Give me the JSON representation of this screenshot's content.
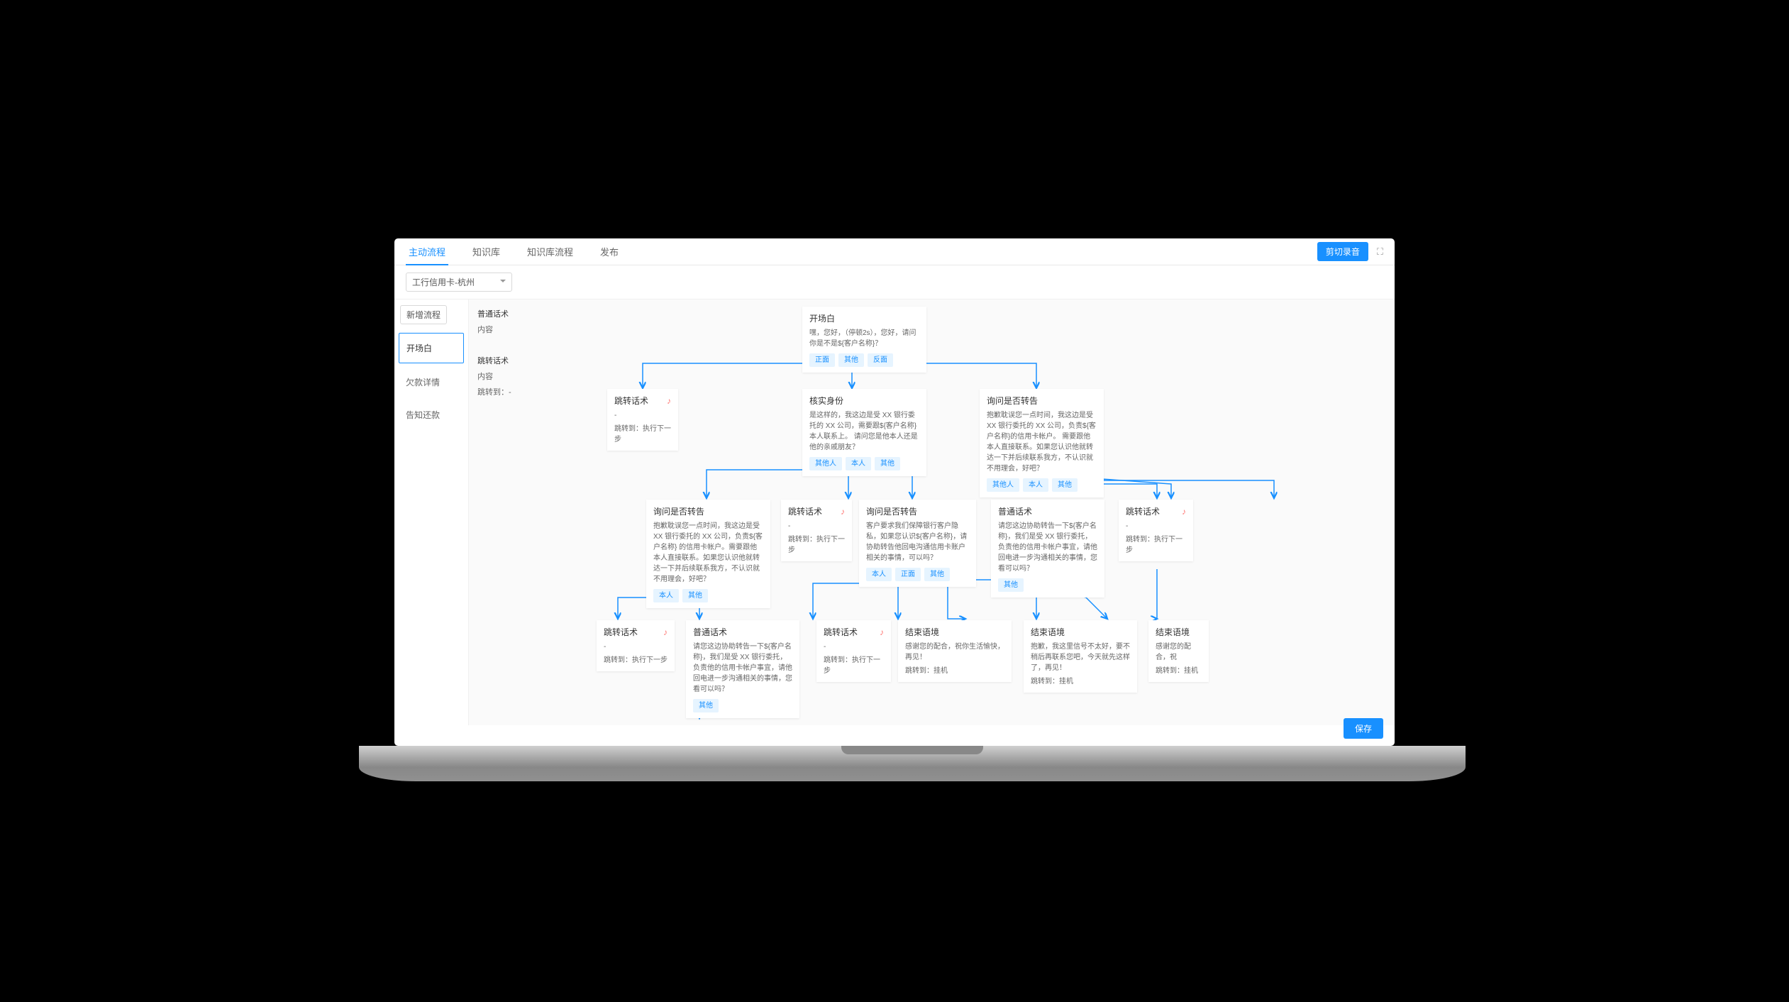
{
  "tabs": [
    "主动流程",
    "知识库",
    "知识库流程",
    "发布"
  ],
  "top_btn": "剪切录音",
  "dropdown": "工行信用卡-杭州",
  "new_flow": "新增流程",
  "side_items": [
    "开场白",
    "欠款详情",
    "告知还款"
  ],
  "panel": {
    "t1": "普通话术",
    "t1b": "内容",
    "t2": "跳转话术",
    "t2b": "内容",
    "t2c": "跳转到：-"
  },
  "save": "保存",
  "n": {
    "open": {
      "t": "开场白",
      "c": "嘿，您好，（停顿2s），您好，请问你是不是${客户名称}？",
      "chips": [
        "正面",
        "其他",
        "反面"
      ]
    },
    "j1": {
      "t": "跳转话术",
      "c": "-",
      "j": "跳转到：执行下一步"
    },
    "verify": {
      "t": "核实身份",
      "c": "是这样的，我这边是受 XX 银行委托的 XX 公司，需要跟${客户名称}本人联系上。\n请问您是他本人还是他的亲戚朋友？",
      "chips": [
        "其他人",
        "本人",
        "其他"
      ]
    },
    "ask1": {
      "t": "询问是否转告",
      "c": "抱歉耽误您一点时间，我这边是受 XX 银行委托的 XX 公司，负责${客户名称}的信用卡帐户。\n需要跟他本人直接联系。如果您认识他就转达一下并后续联系我方，不认识就不用理会，好吧？",
      "chips": [
        "其他人",
        "本人",
        "其他"
      ]
    },
    "ask2": {
      "t": "询问是否转告",
      "c": "抱歉耽误您一点时间，我这边是受 XX 银行委托的 XX 公司，负责${客户名称}\n的信用卡帐户。需要跟他本人直接联系。如果您认识他就转达一下并后续联系我方，不认识就不用理会，好吧？",
      "chips": [
        "本人",
        "其他"
      ]
    },
    "j2": {
      "t": "跳转话术",
      "c": "-",
      "j": "跳转到：执行下一步"
    },
    "ask3": {
      "t": "询问是否转告",
      "c": "客户要求我们保障银行客户隐私，如果您认识${客户名称}，请协助转告他回电沟通信用卡账户相关的事情，可以吗？",
      "chips": [
        "本人",
        "正面",
        "其他"
      ]
    },
    "pt1": {
      "t": "普通话术",
      "c": "请您这边协助转告一下${客户名称}，我们是受 XX 银行委托，负责他的信用卡帐户事宜，请他回电进一步沟通相关的事情，您看可以吗？",
      "chips": [
        "其他"
      ]
    },
    "j3": {
      "t": "跳转话术",
      "c": "-",
      "j": "跳转到：执行下一步"
    },
    "j4": {
      "t": "跳转话术",
      "c": "-",
      "j": "跳转到：执行下一步"
    },
    "pt2": {
      "t": "普通话术",
      "c": "请您这边协助转告一下${客户名称}，我们是受 XX 银行委托，负责他的信用卡帐户事宜，请他回电进一步沟通相关的事情，您看可以吗？",
      "chips": [
        "其他"
      ]
    },
    "j5": {
      "t": "跳转话术",
      "c": "-",
      "j": "跳转到：执行下一步"
    },
    "end1": {
      "t": "结束语境",
      "c": "感谢您的配合，祝你生活愉快，再见！",
      "j": "跳转到：挂机"
    },
    "end2": {
      "t": "结束语境",
      "c": "抱歉，我这里信号不太好，要不稍后再联系您吧，今天就先这样了，再见！",
      "j": "跳转到：挂机"
    },
    "end3": {
      "t": "结束语境",
      "c": "感谢您的配合，祝",
      "j": "跳转到：挂机"
    }
  }
}
